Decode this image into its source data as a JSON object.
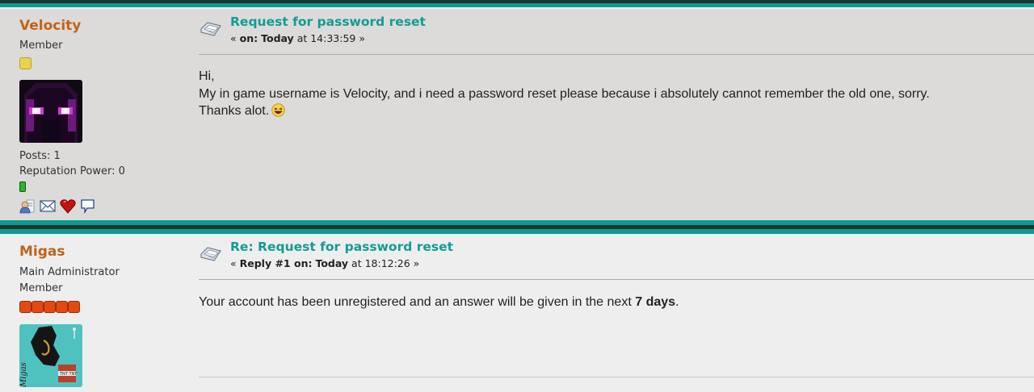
{
  "posts": [
    {
      "username": "Velocity",
      "ranks": [
        "Member"
      ],
      "stats": {
        "posts": "Posts: 1",
        "reputation": "Reputation Power: 0"
      },
      "subject": "Request for password reset",
      "meta": {
        "prefix": "« ",
        "on_label": "on:",
        "day": "Today",
        "time_text": " at 14:33:59 »"
      },
      "body_lines": [
        "Hi,",
        "My in game username is Velocity, and i need a password reset please because i absolutely cannot remember the old one, sorry.",
        "Thanks alot."
      ],
      "icons": [
        "profile-icon",
        "email-icon",
        "heart-icon",
        "speech-bubble-icon"
      ]
    },
    {
      "username": "Migas",
      "ranks": [
        "Main Administrator",
        "Member"
      ],
      "subject": "Re: Request for password reset",
      "meta": {
        "prefix": "« ",
        "reply_label": "Reply #1 on:",
        "day": "Today",
        "time_text": " at 18:12:26 »"
      },
      "body": {
        "text": "Your account has been unregistered and an answer will be given in the next ",
        "bold": "7 days",
        "end": "."
      },
      "avatar_text": "Migas"
    }
  ],
  "colors": {
    "username": "#c0641a",
    "subject": "#139c91",
    "separator_teal": "#0d9a8f",
    "separator_dark": "#1f3532"
  }
}
